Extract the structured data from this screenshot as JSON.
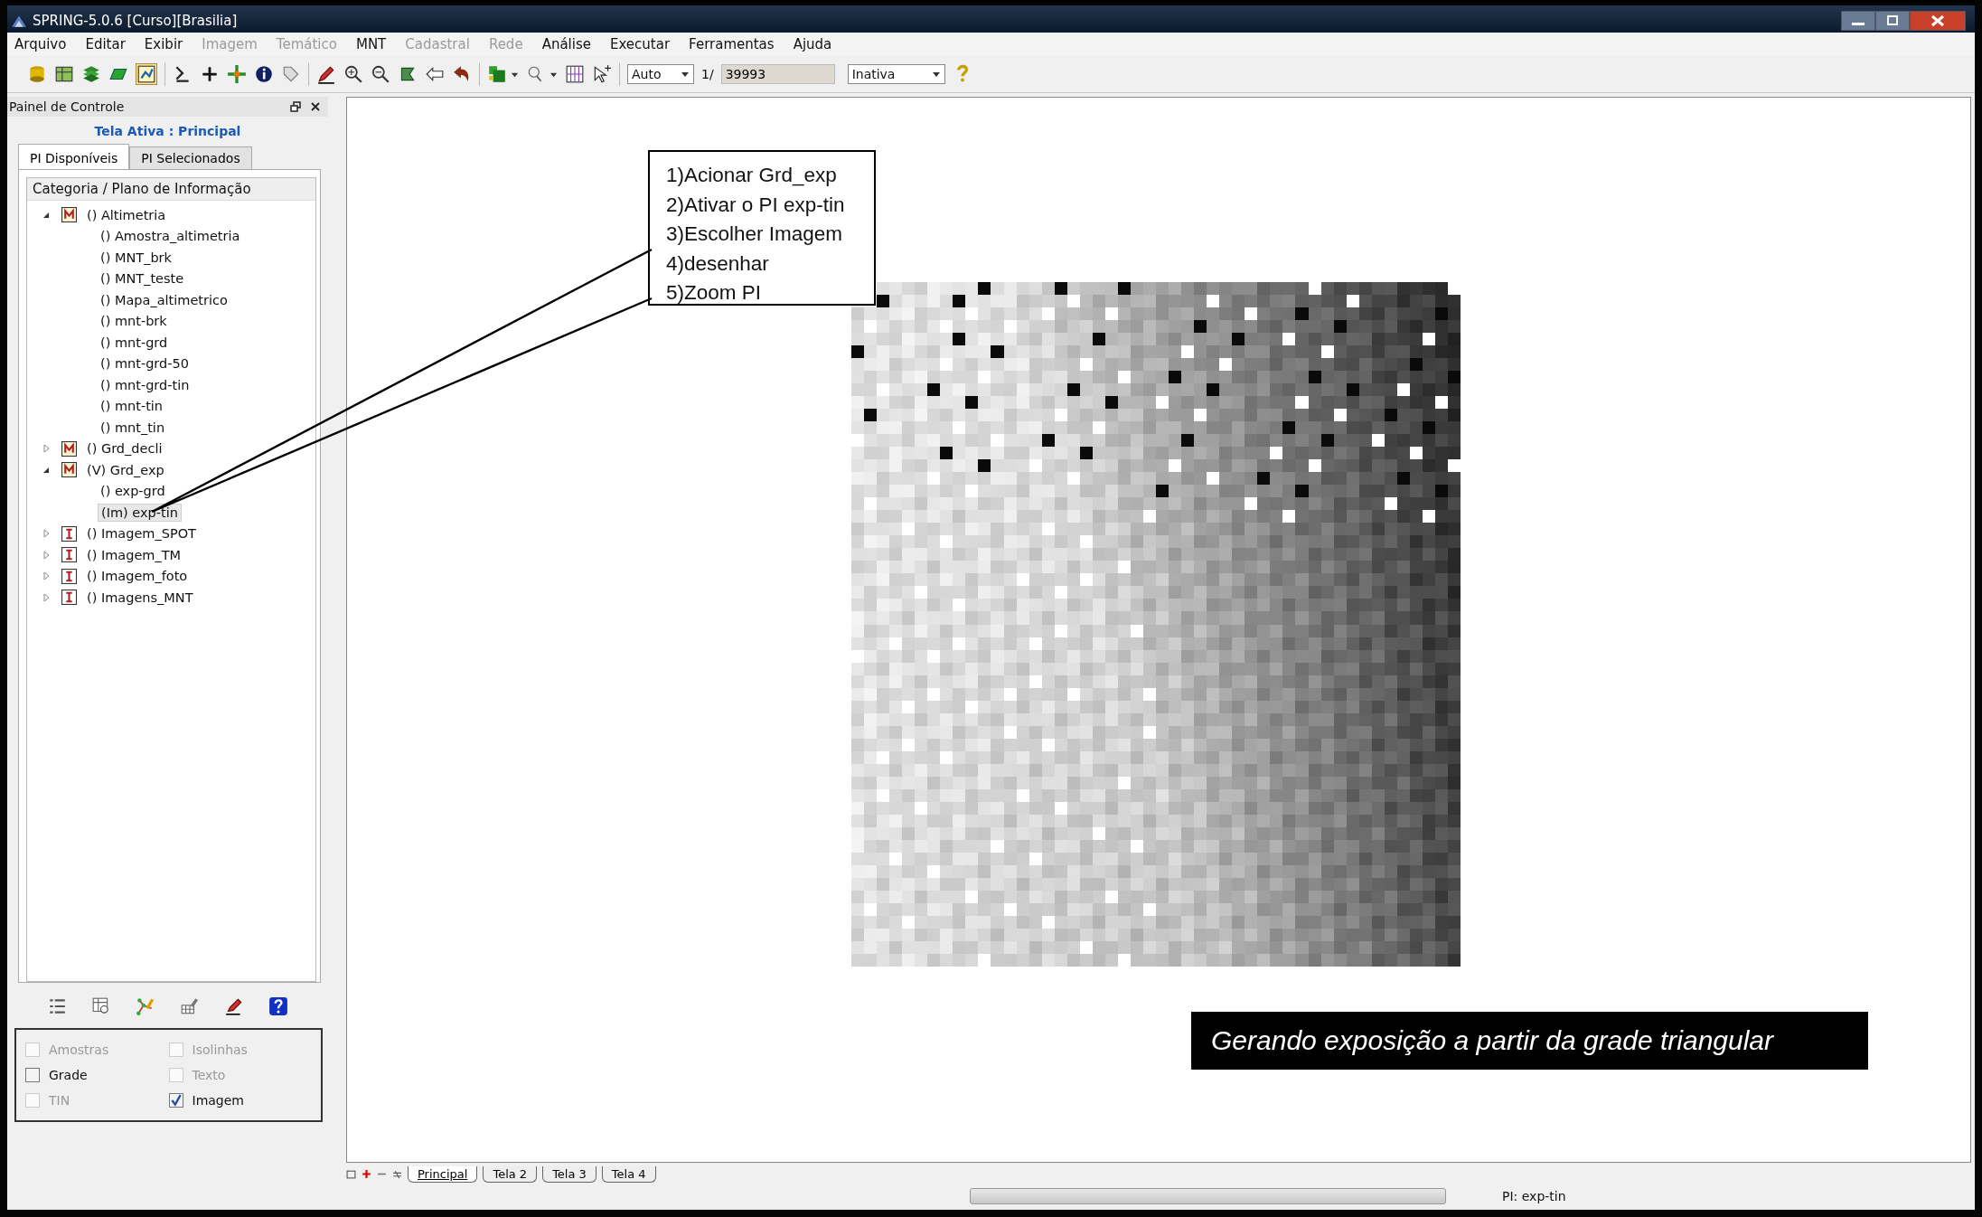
{
  "window": {
    "title": "SPRING-5.0.6 [Curso][Brasilia]"
  },
  "menu": [
    {
      "label": "Arquivo",
      "disabled": false
    },
    {
      "label": "Editar",
      "disabled": false
    },
    {
      "label": "Exibir",
      "disabled": false
    },
    {
      "label": "Imagem",
      "disabled": true
    },
    {
      "label": "Temático",
      "disabled": true
    },
    {
      "label": "MNT",
      "disabled": false
    },
    {
      "label": "Cadastral",
      "disabled": true
    },
    {
      "label": "Rede",
      "disabled": true
    },
    {
      "label": "Análise",
      "disabled": false
    },
    {
      "label": "Executar",
      "disabled": false
    },
    {
      "label": "Ferramentas",
      "disabled": false
    },
    {
      "label": "Ajuda",
      "disabled": false
    }
  ],
  "toolbar": {
    "scale_mode": "Auto",
    "scale_prefix": "1/",
    "scale_value": "39993",
    "cursor_mode": "Inativa"
  },
  "panel": {
    "title": "Painel de Controle",
    "active_screen": "Tela Ativa : Principal",
    "tabs": [
      {
        "label": "PI Disponíveis",
        "selected": true
      },
      {
        "label": "PI Selecionados",
        "selected": false
      }
    ],
    "tree_header": "Categoria / Plano de Informação",
    "tree": [
      {
        "label": "() Altimetria",
        "kind": "mnt",
        "expanded": true,
        "selected": false,
        "children": [
          {
            "label": "() Amostra_altimetria",
            "selected": false
          },
          {
            "label": "() MNT_brk",
            "selected": false
          },
          {
            "label": "() MNT_teste",
            "selected": false
          },
          {
            "label": "() Mapa_altimetrico",
            "selected": false
          },
          {
            "label": "() mnt-brk",
            "selected": false
          },
          {
            "label": "() mnt-grd",
            "selected": false
          },
          {
            "label": "() mnt-grd-50",
            "selected": false
          },
          {
            "label": "() mnt-grd-tin",
            "selected": false
          },
          {
            "label": "() mnt-tin",
            "selected": false
          },
          {
            "label": "() mnt_tin",
            "selected": false
          }
        ]
      },
      {
        "label": "() Grd_decli",
        "kind": "mnt",
        "expanded": false,
        "selected": false
      },
      {
        "label": "(V) Grd_exp",
        "kind": "mnt",
        "expanded": true,
        "selected": false,
        "children": [
          {
            "label": "() exp-grd",
            "selected": false
          },
          {
            "label": "(Im) exp-tin",
            "selected": true
          }
        ]
      },
      {
        "label": "() Imagem_SPOT",
        "kind": "image",
        "expanded": false,
        "selected": false
      },
      {
        "label": "() Imagem_TM",
        "kind": "image",
        "expanded": false,
        "selected": false
      },
      {
        "label": "() Imagem_foto",
        "kind": "image",
        "expanded": false,
        "selected": false
      },
      {
        "label": "() Imagens_MNT",
        "kind": "image",
        "expanded": false,
        "selected": false
      }
    ],
    "options": [
      {
        "label": "Amostras",
        "checked": false,
        "disabled": true
      },
      {
        "label": "Isolinhas",
        "checked": false,
        "disabled": true
      },
      {
        "label": "Grade",
        "checked": false,
        "disabled": false
      },
      {
        "label": "Texto",
        "checked": false,
        "disabled": true
      },
      {
        "label": "TIN",
        "checked": false,
        "disabled": true
      },
      {
        "label": "Imagem",
        "checked": true,
        "disabled": false
      }
    ]
  },
  "canvas": {
    "callout": [
      "1)Acionar Grd_exp",
      "2)Ativar o PI exp-tin",
      "3)Escolher Imagem",
      "4)desenhar",
      "5)Zoom PI"
    ],
    "caption": "Gerando exposição a partir da grade triangular"
  },
  "screen_tabs": [
    {
      "label": "Principal",
      "selected": true
    },
    {
      "label": "Tela 2",
      "selected": false
    },
    {
      "label": "Tela 3",
      "selected": false
    },
    {
      "label": "Tela 4",
      "selected": false
    }
  ],
  "status_bar": {
    "progress": {
      "level": 0
    },
    "text": "PI: exp-tin"
  }
}
